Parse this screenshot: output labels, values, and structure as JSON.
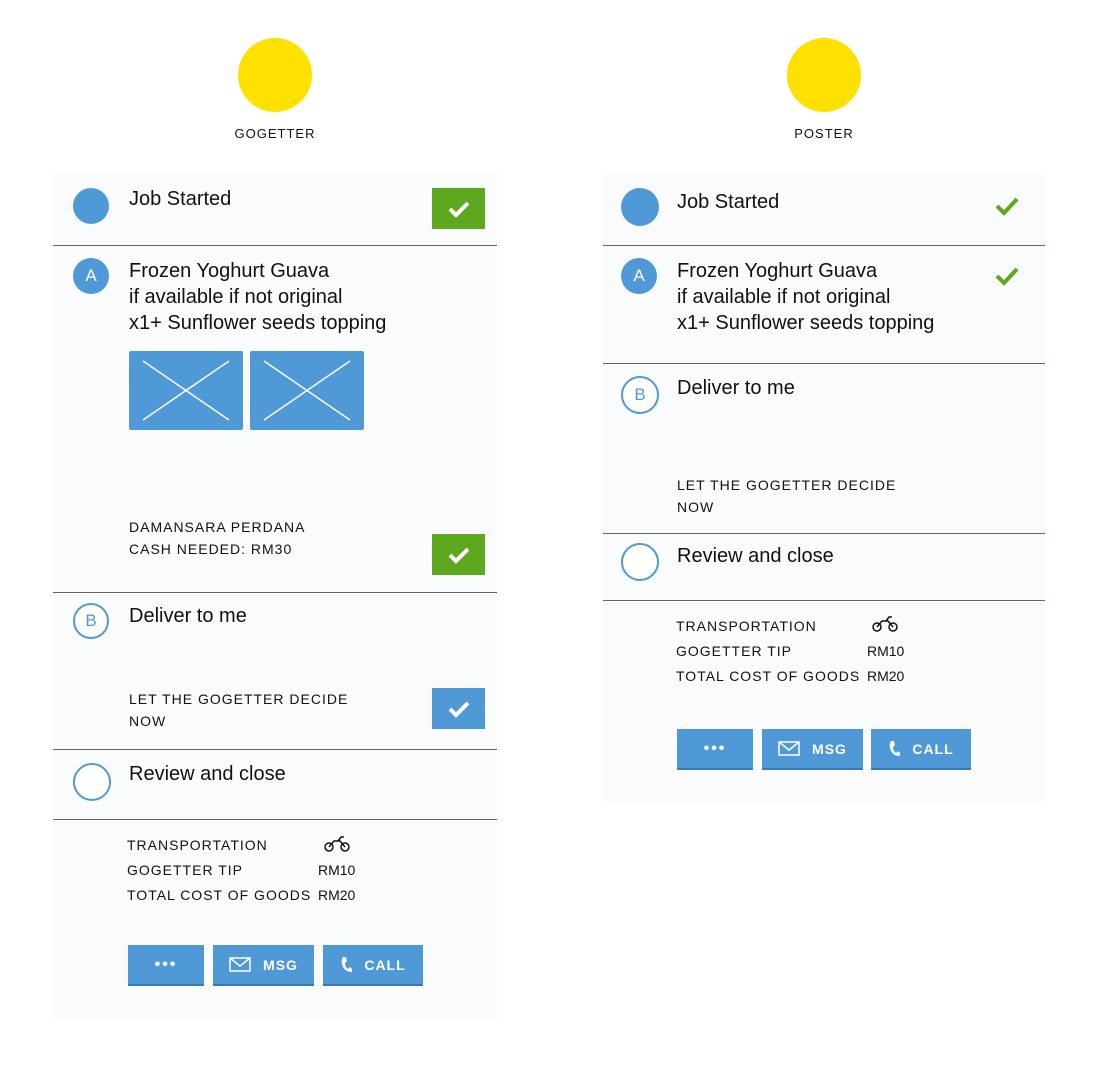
{
  "left": {
    "role": "GOGETTER",
    "step1": {
      "title": "Job Started"
    },
    "step2": {
      "badge": "A",
      "title": "Frozen Yoghurt Guava\nif available if not original\nx1+ Sunflower seeds topping",
      "details": "DAMANSARA PERDANA\nCASH NEEDED: RM30"
    },
    "step3": {
      "badge": "B",
      "title": "Deliver to me",
      "details": "LET THE GOGETTER DECIDE\nNOW"
    },
    "step4": {
      "title": "Review and close"
    },
    "summary": {
      "transport_label": "TRANSPORTATION",
      "tip_label": "GOGETTER TIP",
      "tip_value": "RM10",
      "goods_label": "TOTAL COST OF GOODS",
      "goods_value": "RM20"
    },
    "buttons": {
      "more": "•••",
      "msg": "MSG",
      "call": "CALL"
    }
  },
  "right": {
    "role": "POSTER",
    "step1": {
      "title": "Job Started"
    },
    "step2": {
      "badge": "A",
      "title": "Frozen Yoghurt Guava\nif available if not original\nx1+ Sunflower seeds topping"
    },
    "step3": {
      "badge": "B",
      "title": "Deliver to me",
      "details": "LET THE GOGETTER DECIDE\nNOW"
    },
    "step4": {
      "title": "Review and close"
    },
    "summary": {
      "transport_label": "TRANSPORTATION",
      "tip_label": "GOGETTER TIP",
      "tip_value": "RM10",
      "goods_label": "TOTAL COST OF GOODS",
      "goods_value": "RM20"
    },
    "buttons": {
      "more": "•••",
      "msg": "MSG",
      "call": "CALL"
    }
  },
  "colors": {
    "accent": "#4f9ad6",
    "success": "#5ea820",
    "avatar": "#ffe100"
  },
  "icons": [
    "check-icon",
    "motorbike-icon",
    "envelope-icon",
    "phone-icon",
    "image-placeholder-icon"
  ]
}
